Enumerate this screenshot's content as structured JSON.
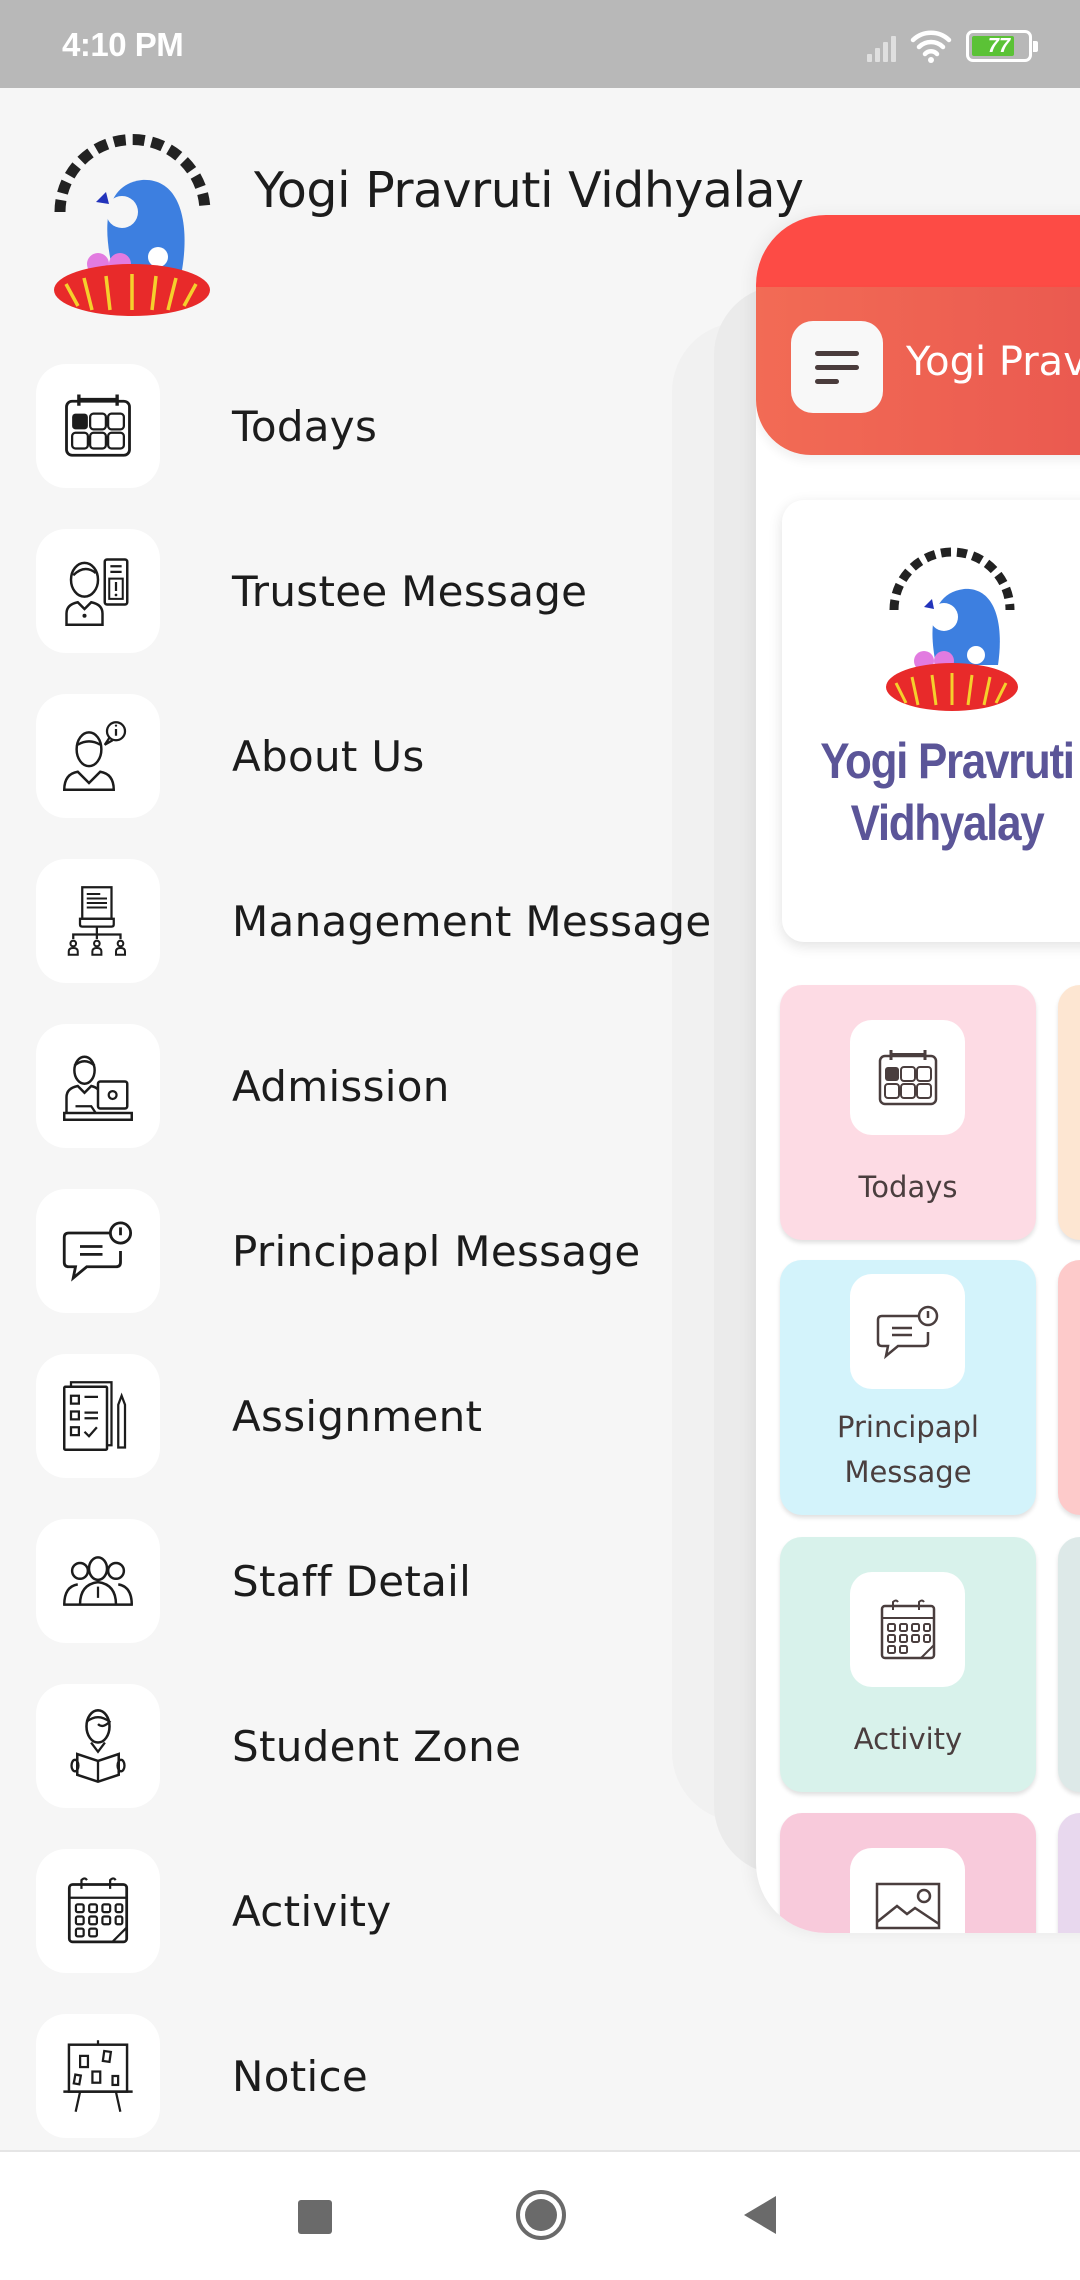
{
  "status_bar": {
    "time": "4:10 PM",
    "battery_level": "77",
    "icons": [
      "signal-icon",
      "wifi-icon",
      "battery-icon"
    ]
  },
  "drawer": {
    "school_name": "Yogi Pravruti Vidhyalay",
    "logo": "school-logo-nest-bird",
    "items": [
      {
        "label": "Todays",
        "icon": "calendar-today-icon"
      },
      {
        "label": "Trustee Message",
        "icon": "trustee-message-icon"
      },
      {
        "label": "About Us",
        "icon": "about-us-icon"
      },
      {
        "label": "Management Message",
        "icon": "management-message-icon"
      },
      {
        "label": "Admission",
        "icon": "admission-icon"
      },
      {
        "label": "Principapl Message",
        "icon": "principal-message-icon"
      },
      {
        "label": "Assignment",
        "icon": "assignment-icon"
      },
      {
        "label": "Staff Detail",
        "icon": "staff-icon"
      },
      {
        "label": "Student Zone",
        "icon": "student-zone-icon"
      },
      {
        "label": "Activity",
        "icon": "activity-calendar-icon"
      },
      {
        "label": "Notice",
        "icon": "notice-board-icon"
      }
    ]
  },
  "home": {
    "appbar_title": "Yogi Pravruti Vidhyalay",
    "banner_title_line1": "Yogi Pravruti",
    "banner_title_line2": "Vidhyalay",
    "accent_color": "#fd4b45",
    "tiles": [
      {
        "label": "Todays",
        "icon": "calendar-today-icon",
        "color": "#fddbe4"
      },
      {
        "label": "Principapl Message",
        "icon": "principal-message-icon",
        "color": "#d3f3fb"
      },
      {
        "label": "Activity",
        "icon": "activity-calendar-icon",
        "color": "#d8f2eb"
      },
      {
        "label": "",
        "icon": "gallery-image-icon",
        "color": "#f8cadb"
      }
    ],
    "partial_tiles_colors": [
      "#fde6d2",
      "#fdcaca",
      "#dde9e8",
      "#e8d8ee"
    ]
  },
  "nav_bar": {
    "buttons": [
      "recent-apps",
      "home",
      "back"
    ]
  }
}
